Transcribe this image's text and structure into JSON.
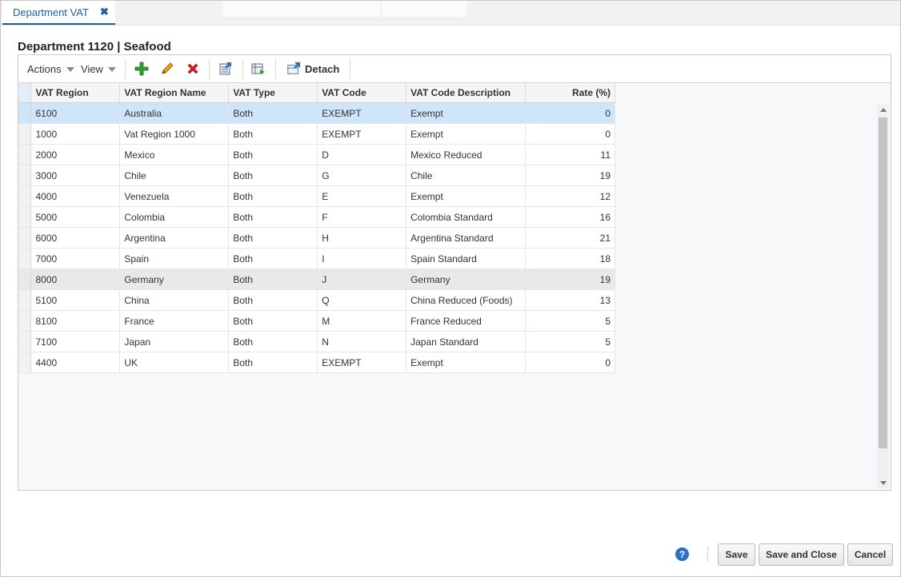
{
  "tab": {
    "label": "Department VAT",
    "close": "✖"
  },
  "page_title": "Department 1120 | Seafood",
  "toolbar": {
    "actions": "Actions",
    "view": "View",
    "detach": "Detach"
  },
  "columns": [
    "VAT Region",
    "VAT Region Name",
    "VAT Type",
    "VAT Code",
    "VAT Code Description",
    "Rate (%)"
  ],
  "rows": [
    [
      "6100",
      "Australia",
      "Both",
      "EXEMPT",
      "Exempt",
      "0"
    ],
    [
      "1000",
      "Vat Region 1000",
      "Both",
      "EXEMPT",
      "Exempt",
      "0"
    ],
    [
      "2000",
      "Mexico",
      "Both",
      "D",
      "Mexico Reduced",
      "11"
    ],
    [
      "3000",
      "Chile",
      "Both",
      "G",
      "Chile",
      "19"
    ],
    [
      "4000",
      "Venezuela",
      "Both",
      "E",
      "Exempt",
      "12"
    ],
    [
      "5000",
      "Colombia",
      "Both",
      "F",
      "Colombia Standard",
      "16"
    ],
    [
      "6000",
      "Argentina",
      "Both",
      "H",
      "Argentina Standard",
      "21"
    ],
    [
      "7000",
      "Spain",
      "Both",
      "I",
      "Spain Standard",
      "18"
    ],
    [
      "8000",
      "Germany",
      "Both",
      "J",
      "Germany",
      "19"
    ],
    [
      "5100",
      "China",
      "Both",
      "Q",
      "China Reduced (Foods)",
      "13"
    ],
    [
      "8100",
      "France",
      "Both",
      "M",
      "France Reduced",
      "5"
    ],
    [
      "7100",
      "Japan",
      "Both",
      "N",
      "Japan Standard",
      "5"
    ],
    [
      "4400",
      "UK",
      "Both",
      "EXEMPT",
      "Exempt",
      "0"
    ]
  ],
  "footer": {
    "help": "?",
    "save": "Save",
    "save_close": "Save and Close",
    "cancel": "Cancel"
  },
  "colors": {
    "accent": "#1e5f9e",
    "selected_row": "#cfe5fa",
    "add_icon": "#2e9e2e",
    "delete_icon": "#d42020",
    "edit_icon": "#e0a020"
  }
}
